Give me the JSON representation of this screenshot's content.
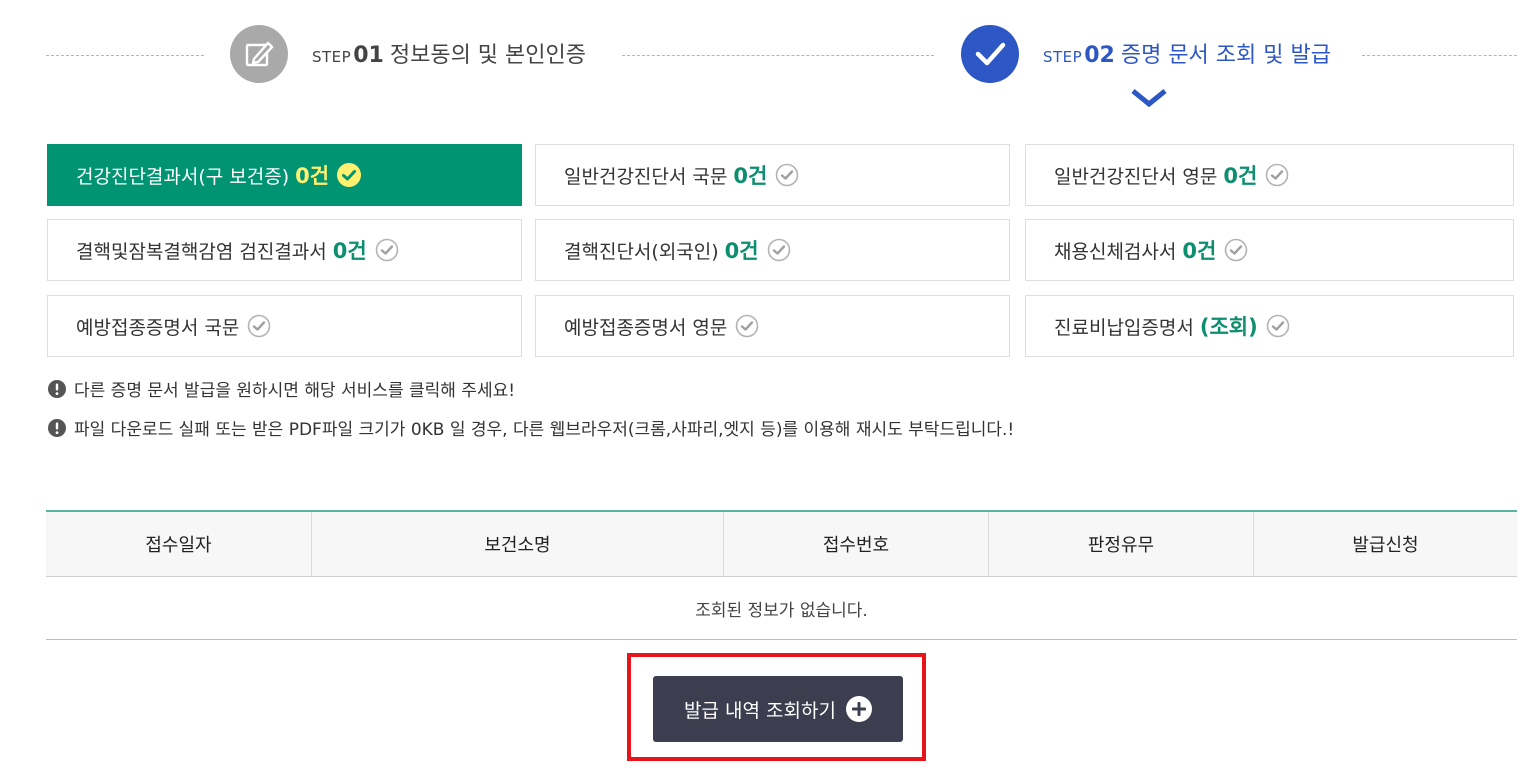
{
  "steps": [
    {
      "word": "STEP",
      "num": "01",
      "label": "정보동의 및 본인인증",
      "state": "done",
      "icon": "pencil-edit-icon",
      "color": "#a9a9a9"
    },
    {
      "word": "STEP",
      "num": "02",
      "label": "증명 문서 조회 및 발급",
      "state": "current",
      "icon": "checkmark-icon",
      "color": "#2d57c5"
    }
  ],
  "documents": [
    {
      "label": "건강진단결과서(구 보건증)",
      "count": "0건",
      "active": true
    },
    {
      "label": "일반건강진단서 국문",
      "count": "0건",
      "active": false
    },
    {
      "label": "일반건강진단서 영문",
      "count": "0건",
      "active": false
    },
    {
      "label": "결핵및잠복결핵감염 검진결과서",
      "count": "0건",
      "active": false
    },
    {
      "label": "결핵진단서(외국인)",
      "count": "0건",
      "active": false
    },
    {
      "label": "채용신체검사서",
      "count": "0건",
      "active": false
    },
    {
      "label": "예방접종증명서 국문",
      "count": "",
      "active": false
    },
    {
      "label": "예방접종증명서 영문",
      "count": "",
      "active": false
    },
    {
      "label": "진료비납입증명서",
      "count": "(조회)",
      "active": false
    }
  ],
  "notices": [
    "다른 증명 문서 발급을 원하시면 해당 서비스를 클릭해 주세요!",
    "파일 다운로드 실패 또는 받은 PDF파일 크기가 0KB 일 경우, 다른 웹브라우저(크롬,사파리,엣지 등)를 이용해 재시도 부탁드립니다.!"
  ],
  "table": {
    "columns": [
      "접수일자",
      "보건소명",
      "접수번호",
      "판정유무",
      "발급신청"
    ],
    "empty_message": "조회된 정보가 없습니다."
  },
  "history_button": {
    "label": "발급 내역 조회하기",
    "icon": "plus-circle-icon"
  },
  "colors": {
    "accent_green": "#009472",
    "count_green": "#0d8f6f",
    "active_count": "#fff16f",
    "step_blue": "#2d57c5",
    "button_dark": "#3c3d4f",
    "highlight_red": "#e8141c"
  }
}
